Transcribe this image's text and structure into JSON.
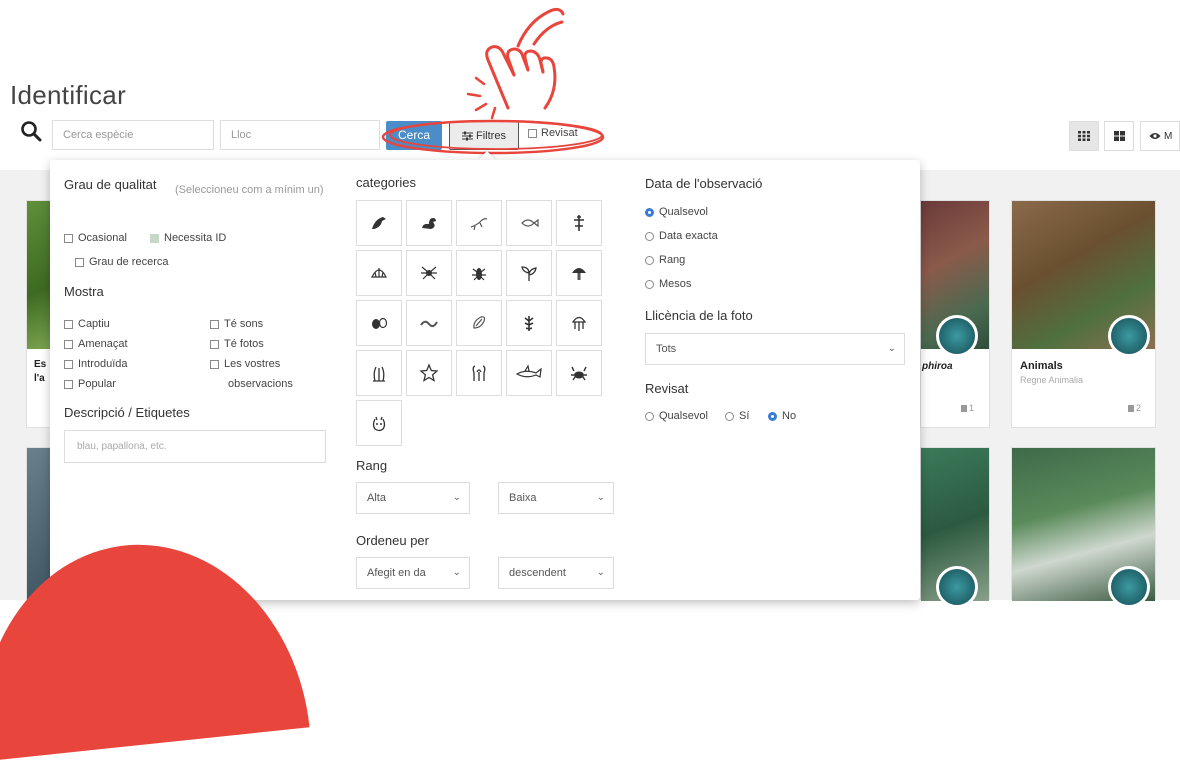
{
  "page": {
    "title": "Identificar"
  },
  "toolbar": {
    "species_placeholder": "Cerca espècie",
    "place_placeholder": "Lloc",
    "search_button": "Cerca",
    "filters_button": "Filtres",
    "reviewed_label": "Revisat",
    "view_label_fragment": "M"
  },
  "panel": {
    "quality": {
      "title": "Grau de qualitat",
      "hint": "(Seleccioneu com a mínim un)",
      "options": [
        "Ocasional",
        "Necessita ID",
        "Grau de recerca"
      ]
    },
    "sample": {
      "title": "Mostra",
      "left": [
        "Captiu",
        "Amenaçat",
        "Introduïda",
        "Popular"
      ],
      "right": [
        "Té sons",
        "Té fotos",
        "Les vostres",
        "observacions"
      ]
    },
    "description": {
      "title": "Descripció / Etiquetes",
      "placeholder": "blau, papallona, etc."
    },
    "categories": {
      "title": "categories",
      "icons": [
        "bird-icon",
        "duck-icon",
        "amphibian-icon",
        "fish-icon",
        "reptile-icon",
        "shell-icon",
        "spider-icon",
        "insect-icon",
        "plant-icon",
        "fungus-icon",
        "eggs-icon",
        "worm-icon",
        "seaweed-icon",
        "coral-icon",
        "jellyfish-icon",
        "sea-plant-icon",
        "starfish-icon",
        "anemone-icon",
        "shark-icon",
        "crab-icon",
        "other-icon"
      ]
    },
    "rank": {
      "title": "Rang",
      "high": "Alta",
      "low": "Baixa"
    },
    "order": {
      "title": "Ordeneu per",
      "field": "Afegit en da",
      "direction": "descendent"
    },
    "date": {
      "title": "Data de l'observació",
      "options": [
        "Qualsevol",
        "Data exacta",
        "Rang",
        "Mesos"
      ],
      "selected": 0
    },
    "license": {
      "title": "Llicència de la foto",
      "value": "Tots"
    },
    "reviewed": {
      "title": "Revisat",
      "options": [
        "Qualsevol",
        "Sí",
        "No"
      ],
      "selected": 2
    }
  },
  "cards": [
    {
      "partial_title_1": "Es",
      "partial_title_2": "l'a"
    },
    {
      "partial_title": "phiroa",
      "count": "1"
    },
    {
      "title": "Animals",
      "subtitle": "Regne Animalia",
      "count": "2"
    }
  ],
  "colors": {
    "accent": "#4a8dc9",
    "highlight": "#e8453c"
  }
}
